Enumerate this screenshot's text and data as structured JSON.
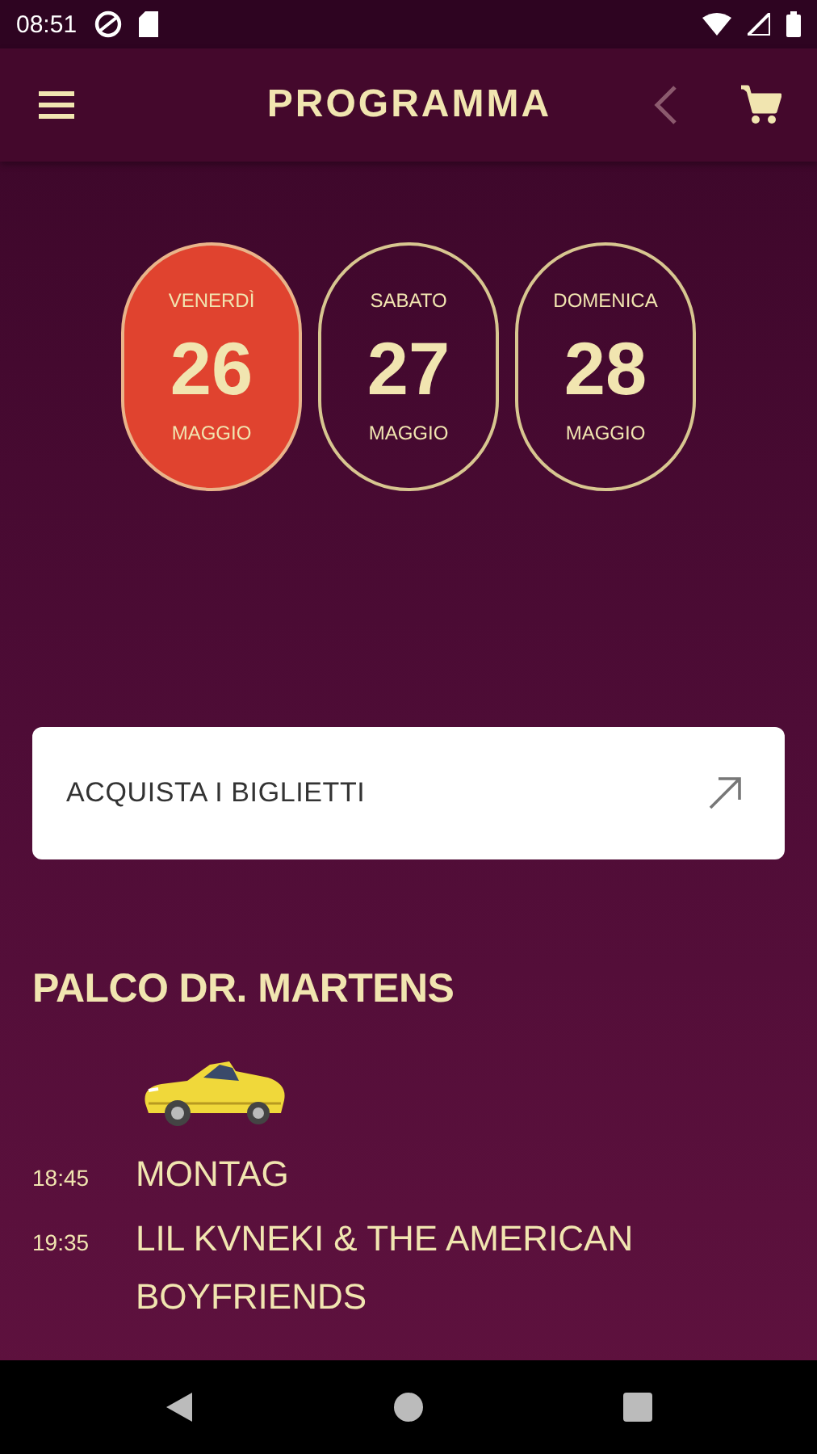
{
  "status_bar": {
    "time": "08:51"
  },
  "app_bar": {
    "title": "PROGRAMMA"
  },
  "days": [
    {
      "weekday": "VENERDÌ",
      "day": "26",
      "month": "MAGGIO",
      "selected": true
    },
    {
      "weekday": "SABATO",
      "day": "27",
      "month": "MAGGIO",
      "selected": false
    },
    {
      "weekday": "DOMENICA",
      "day": "28",
      "month": "MAGGIO",
      "selected": false
    }
  ],
  "tickets_button": {
    "label": "ACQUISTA I BIGLIETTI"
  },
  "stage": {
    "title": "PALCO DR. MARTENS",
    "performances": [
      {
        "time": "18:45",
        "artist": "MONTAG"
      },
      {
        "time": "19:35",
        "artist": "LIL KVNEKI & THE AMERICAN BOYFRIENDS"
      }
    ]
  }
}
